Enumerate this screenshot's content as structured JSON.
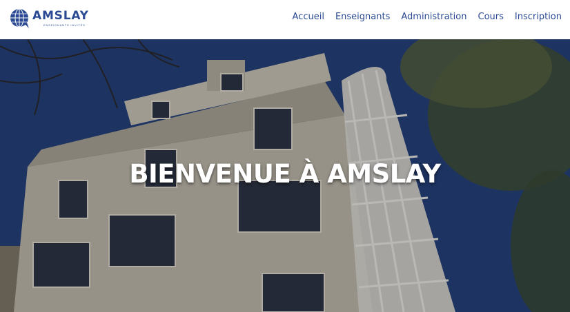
{
  "brand": {
    "name": "AMSLAY",
    "tagline": "ENSEIGNANTS INVITÉS"
  },
  "nav": {
    "items": [
      "Accueil",
      "Enseignants",
      "Administration",
      "Cours",
      "Inscription"
    ]
  },
  "hero": {
    "title": "BIENVENUE À AMSLAY"
  },
  "colors": {
    "brand": "#2b4a93",
    "sky": "#223a68",
    "building": "#c8c3b8"
  }
}
